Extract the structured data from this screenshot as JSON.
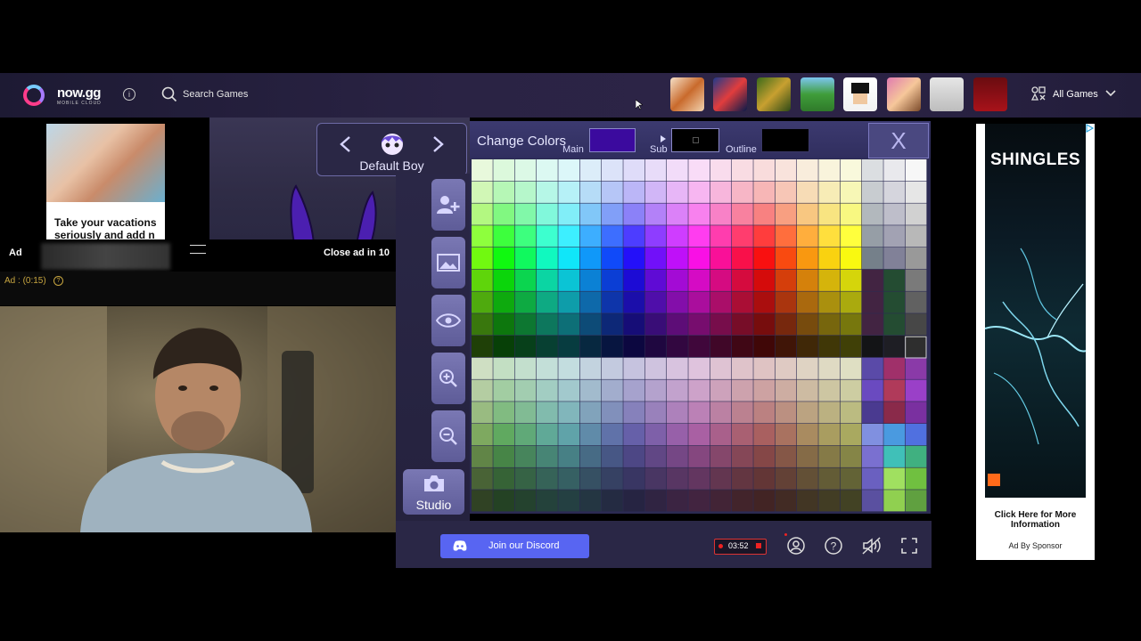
{
  "header": {
    "logo_text": "now.gg",
    "logo_sub": "MOBILE CLOUD",
    "search_label": "Search Games",
    "all_games_label": "All Games",
    "game_thumbs": [
      "game-1",
      "game-2",
      "game-3",
      "game-4",
      "game-5",
      "game-6",
      "game-7",
      "game-8"
    ]
  },
  "left_ad": {
    "text": "Take your vacations seriously and add n"
  },
  "video_ad": {
    "label": "Ad",
    "close_text": "Close ad in 10",
    "timer": "Ad : (0:15)",
    "help": "?"
  },
  "character": {
    "name": "Default Boy"
  },
  "tools": {
    "studio_label": "Studio"
  },
  "palette": {
    "title": "Change Colors",
    "main_label": "Main",
    "sub_label": "Sub",
    "outline_label": "Outline",
    "close_label": "X",
    "main_color": "#3b0a9e",
    "sub_color": "#000000",
    "outline_color": "#000000"
  },
  "bottom": {
    "discord_label": "Join our Discord",
    "rec_time": "03:52"
  },
  "right_ad": {
    "title": "SHINGLES",
    "cta": "Click Here for More Information",
    "sponsor": "Ad By Sponsor"
  }
}
